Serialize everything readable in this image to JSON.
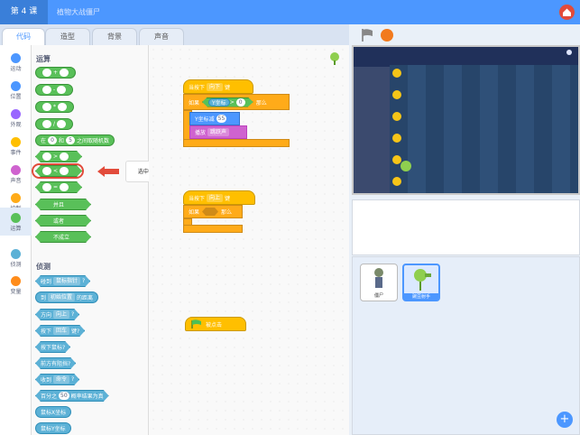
{
  "header": {
    "lesson": "第 4 课",
    "breadcrumb": "植物大战僵尸"
  },
  "tabs": [
    {
      "label": "代码"
    },
    {
      "label": "造型"
    },
    {
      "label": "背景"
    },
    {
      "label": "声音"
    }
  ],
  "categories": [
    {
      "label": "运动",
      "color": "#4c97ff"
    },
    {
      "label": "位置",
      "color": "#4c97ff"
    },
    {
      "label": "外观",
      "color": "#9966ff"
    },
    {
      "label": "事件",
      "color": "#ffbf00"
    },
    {
      "label": "声音",
      "color": "#cf63cf"
    },
    {
      "label": "控制",
      "color": "#ffab19"
    },
    {
      "label": "运算",
      "color": "#59c059"
    },
    {
      "label": "侦测",
      "color": "#5cb1d6"
    },
    {
      "label": "变量",
      "color": "#ff8c1a"
    }
  ],
  "palette": {
    "operators_title": "运算",
    "op_add": "+",
    "op_sub": "-",
    "op_mul": "*",
    "op_div": "/",
    "random_prefix": "在",
    "random_from": "0",
    "random_and": "和",
    "random_to": "5",
    "random_suffix": "之间取随机数",
    "op_gt": ">",
    "op_lt": "<",
    "op_eq": "=",
    "op_and": "并且",
    "op_or": "或者",
    "op_not": "不成立",
    "sensing_title": "侦测",
    "touching": "碰到",
    "touching_arg": "鼠标指针",
    "touching_q": "?",
    "distance_prefix": "到",
    "distance_arg": "初始位置",
    "distance_suffix": "的距离",
    "key_dir_prefix": "方向",
    "key_dir_arg": "向上",
    "key_dir_q": "?",
    "key_pressed_prefix": "按下",
    "key_pressed_arg": "回车",
    "key_pressed_q": "键?",
    "mouse_down": "按下鼠标?",
    "obstacle": "前方有阻挡?",
    "receive_prefix": "收到",
    "receive_arg": "命令",
    "receive_q": "?",
    "percent_prefix": "百分之",
    "percent_value": "50",
    "percent_suffix": "概率结果为真",
    "mouse_x": "鼠标X坐标",
    "mouse_y": "鼠标Y坐标"
  },
  "callout": {
    "text": "选中“小于”判断模块"
  },
  "scripts": {
    "s1_hat_prefix": "当按下",
    "s1_hat_key": "向下",
    "s1_hat_suffix": "键",
    "s1_if": "如果",
    "s1_ycoord": "Y坐标",
    "s1_gt": ">",
    "s1_val": "0",
    "s1_then": "那么",
    "s1_change": "Y坐标减",
    "s1_change_val": "55",
    "s1_play": "播放",
    "s1_sound": "跳跃声",
    "s2_hat_prefix": "当按下",
    "s2_hat_key": "向上",
    "s2_hat_suffix": "键",
    "s2_if": "如果",
    "s2_then": "那么",
    "s3_hat": "被点击"
  },
  "sprites": [
    {
      "name": "僵尸"
    },
    {
      "name": "豌豆射手"
    }
  ],
  "add_button": "+"
}
